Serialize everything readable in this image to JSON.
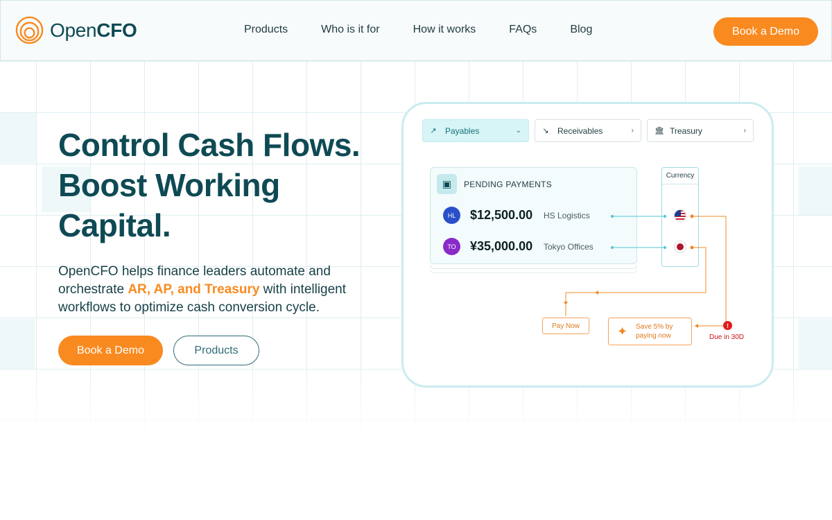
{
  "brand": {
    "name_light": "Open",
    "name_bold": "CFO"
  },
  "nav": {
    "items": [
      "Products",
      "Who is it for",
      "How it works",
      "FAQs",
      "Blog"
    ],
    "cta": "Book a Demo"
  },
  "hero": {
    "title_lines": [
      "Control Cash Flows.",
      "Boost Working",
      "Capital."
    ],
    "desc_before": "OpenCFO helps finance leaders automate and orchestrate ",
    "desc_highlight": "AR, AP, and Treasury",
    "desc_after": " with intelligent workflows to optimize cash conversion cycle.",
    "primary_button": "Book a Demo",
    "secondary_button": "Products"
  },
  "illustration": {
    "tabs": [
      {
        "label": "Payables",
        "icon": "arrow-up-right-icon"
      },
      {
        "label": "Receivables",
        "icon": "arrow-down-right-icon"
      },
      {
        "label": "Treasury",
        "icon": "bank-icon"
      }
    ],
    "pending_title": "PENDING PAYMENTS",
    "payments": [
      {
        "initials": "HL",
        "amount": "$12,500.00",
        "payee": "HS Logistics",
        "color": "#2b4fc9"
      },
      {
        "initials": "TO",
        "amount": "¥35,000.00",
        "payee": "Tokyo Offices",
        "color": "#8a2bc9"
      }
    ],
    "currency_label": "Currency",
    "pay_now": "Pay Now",
    "save_line1": "Save 5% by",
    "save_line2": "paying now",
    "due": "Due in 30D",
    "alert_mark": "!"
  },
  "colors": {
    "accent": "#f98a20",
    "brand_dark": "#0e4a54",
    "teal_line": "#4fc7d3",
    "alert": "#e21b1b"
  }
}
